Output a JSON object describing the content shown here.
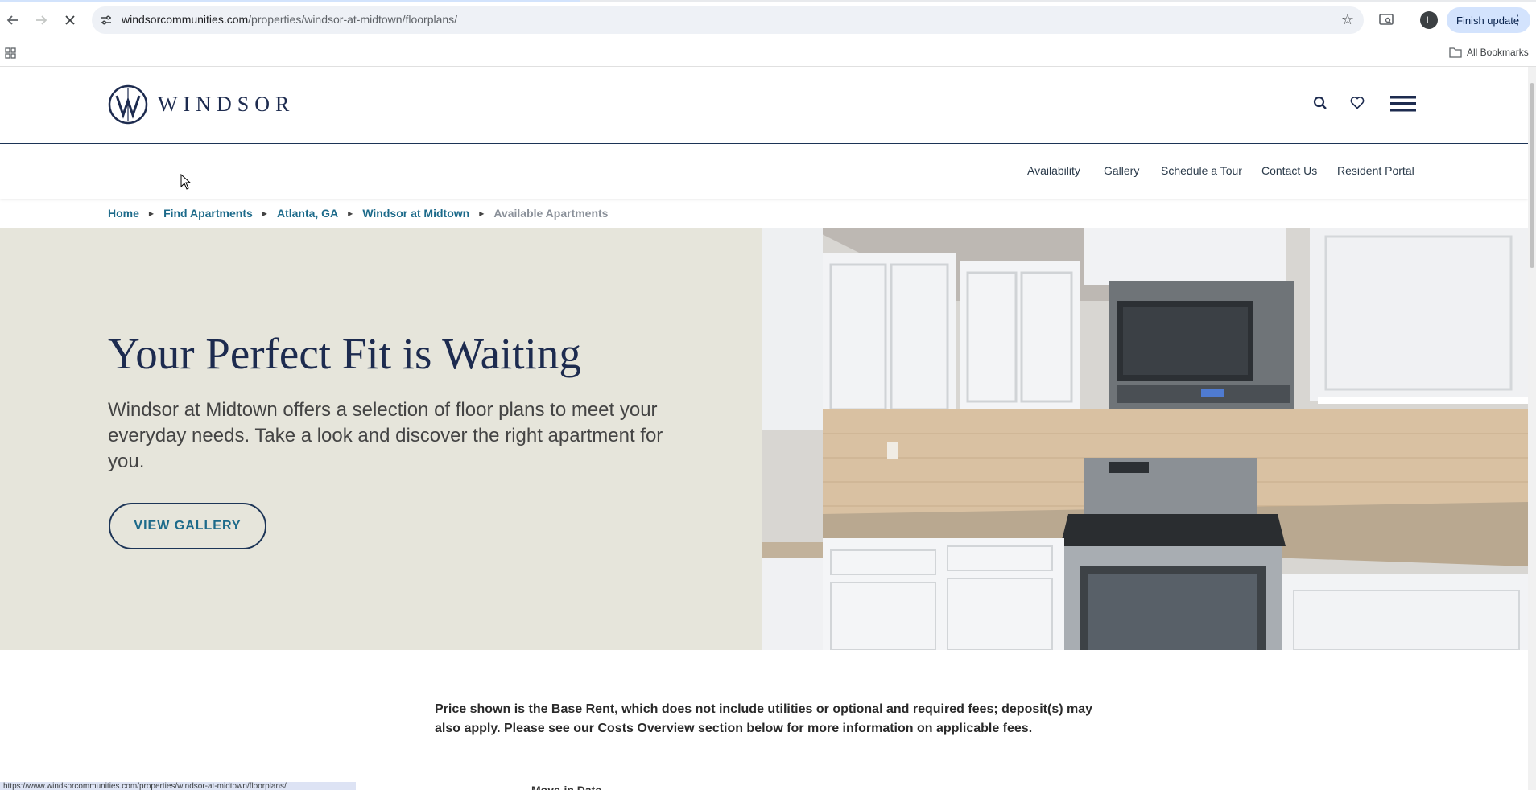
{
  "browser": {
    "url_domain": "windsorcommunities.com",
    "url_path": "/properties/windsor-at-midtown/floorplans/",
    "profile_initial": "L",
    "finish_update_label": "Finish update",
    "all_bookmarks_label": "All Bookmarks",
    "status_url": "https://www.windsorcommunities.com/properties/windsor-at-midtown/floorplans/"
  },
  "site": {
    "logo_text": "WINDSOR",
    "subnav": [
      "Availability",
      "Gallery",
      "Schedule a Tour",
      "Contact Us",
      "Resident Portal"
    ],
    "breadcrumbs": [
      "Home",
      "Find Apartments",
      "Atlanta, GA",
      "Windsor at Midtown",
      "Available Apartments"
    ]
  },
  "hero": {
    "title": "Your Perfect Fit is Waiting",
    "description": "Windsor at Midtown offers a selection of floor plans to meet your everyday needs. Take a look and discover the right apartment for you.",
    "button_label": "VIEW GALLERY"
  },
  "price_note": "Price shown is the Base Rent, which does not include utilities or optional and required fees; deposit(s) may also apply. Please see our Costs Overview section below for more information on applicable fees.",
  "next_section_peek": "Move-in Date",
  "colors": {
    "navy": "#1d2b4f",
    "teal_link": "#1c6a8a",
    "hero_bg": "#e6e5db"
  }
}
